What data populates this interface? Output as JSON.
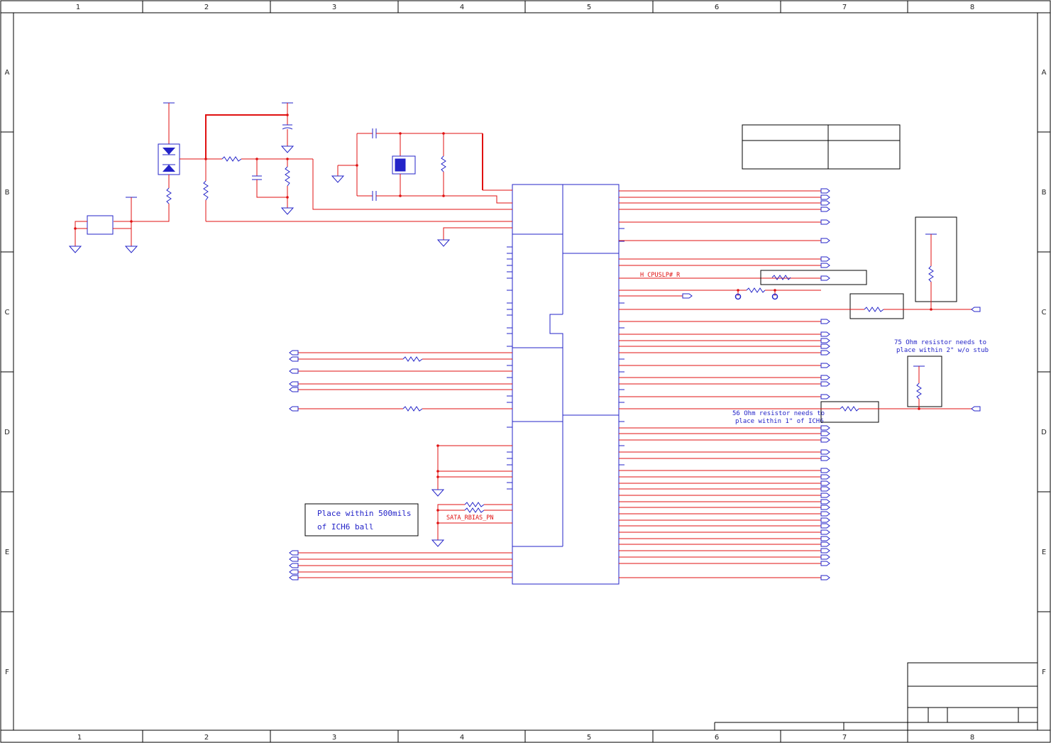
{
  "border": {
    "columns": [
      "1",
      "2",
      "3",
      "4",
      "5",
      "6",
      "7",
      "8"
    ],
    "rows": [
      "A",
      "B",
      "C",
      "D",
      "E",
      "F"
    ]
  },
  "nets": {
    "cpuslp": "H_CPUSLP#_R",
    "sata_rbias": "SATA_RBIAS_PN"
  },
  "notes": {
    "placement_line1": "Place within 500mils",
    "placement_line2": "of ICH6 ball",
    "r75_line1": "75 Ohm resistor needs to",
    "r75_line2": "place within 2\" w/o stub",
    "r56_line1": "56 Ohm resistor needs to",
    "r56_line2": "place within 1\" of ICH6"
  },
  "colors": {
    "wire": "#e01010",
    "symbol": "#2323c8",
    "frame": "#000000"
  }
}
